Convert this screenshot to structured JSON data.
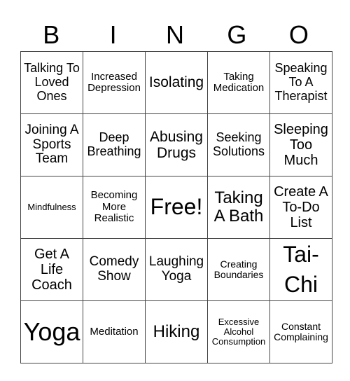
{
  "header": [
    "B",
    "I",
    "N",
    "G",
    "O"
  ],
  "rows": [
    [
      "Talking To Loved Ones",
      "Increased Depression",
      "Isolating",
      "Taking Medication",
      "Speaking To A Therapist"
    ],
    [
      "Joining A Sports Team",
      "Deep Breathing",
      "Abusing Drugs",
      "Seeking Solutions",
      "Sleeping Too Much"
    ],
    [
      "Mindfulness",
      "Becoming More Realistic",
      "Free!",
      "Taking A Bath",
      "Create A To-Do List"
    ],
    [
      "Get A Life Coach",
      "Comedy Show",
      "Laughing Yoga",
      "Creating Boundaries",
      "Tai-Chi"
    ],
    [
      "Yoga",
      "Meditation",
      "Hiking",
      "Excessive Alcohol Consumption",
      "Constant Complaining"
    ]
  ]
}
